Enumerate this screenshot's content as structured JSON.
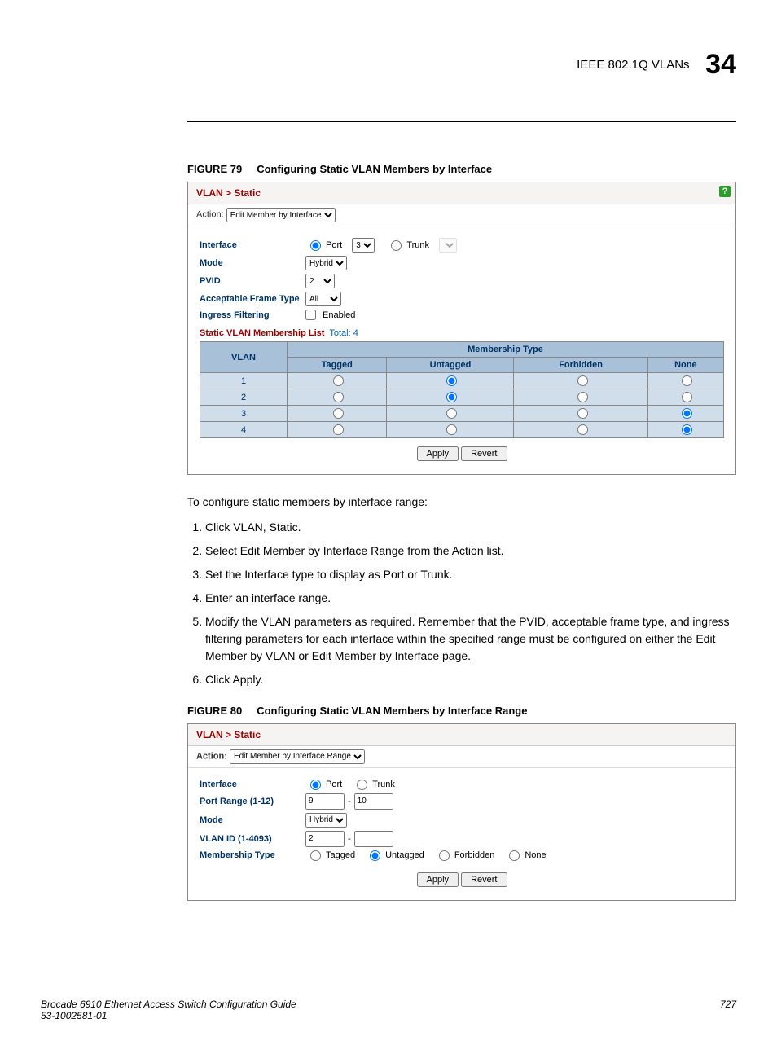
{
  "header": {
    "section": "IEEE 802.1Q VLANs",
    "chapter": "34"
  },
  "fig79": {
    "label": "FIGURE 79",
    "caption": "Configuring Static VLAN Members by Interface",
    "breadcrumb": "VLAN > Static",
    "action_label": "Action:",
    "action_value": "Edit Member by Interface",
    "rows": {
      "interface": "Interface",
      "port_label": "Port",
      "port_value": "3",
      "trunk_label": "Trunk",
      "mode": "Mode",
      "mode_value": "Hybrid",
      "pvid": "PVID",
      "pvid_value": "2",
      "aft": "Acceptable Frame Type",
      "aft_value": "All",
      "ingress": "Ingress Filtering",
      "enabled": "Enabled"
    },
    "list_title_red": "Static VLAN Membership List",
    "list_title_blue": "Total: 4",
    "table": {
      "vlan_header": "VLAN",
      "membership_header": "Membership Type",
      "cols": [
        "Tagged",
        "Untagged",
        "Forbidden",
        "None"
      ],
      "rows": [
        {
          "vlan": "1",
          "sel": 1
        },
        {
          "vlan": "2",
          "sel": 1
        },
        {
          "vlan": "3",
          "sel": 3
        },
        {
          "vlan": "4",
          "sel": 3
        }
      ]
    },
    "apply": "Apply",
    "revert": "Revert"
  },
  "intro": "To configure static members by interface range:",
  "steps": [
    "Click VLAN, Static.",
    "Select Edit Member by Interface Range from the Action list.",
    "Set the Interface type to display as Port or Trunk.",
    "Enter an interface range.",
    "Modify the VLAN parameters as required. Remember that the PVID, acceptable frame type, and ingress filtering parameters for each interface within the specified range must be configured on either the Edit Member by VLAN or Edit Member by Interface page.",
    "Click Apply."
  ],
  "fig80": {
    "label": "FIGURE 80",
    "caption": "Configuring Static VLAN Members by Interface Range",
    "breadcrumb": "VLAN > Static",
    "action_label": "Action:",
    "action_value": "Edit Member by Interface Range",
    "rows": {
      "interface": "Interface",
      "port": "Port",
      "trunk": "Trunk",
      "range": "Port Range (1-12)",
      "range_from": "9",
      "range_to": "10",
      "mode": "Mode",
      "mode_value": "Hybrid",
      "vlanid": "VLAN ID (1-4093)",
      "vlanid_value": "2",
      "mtype": "Membership Type",
      "tagged": "Tagged",
      "untagged": "Untagged",
      "forbidden": "Forbidden",
      "none": "None"
    },
    "apply": "Apply",
    "revert": "Revert"
  },
  "footer": {
    "left1": "Brocade 6910 Ethernet Access Switch Configuration Guide",
    "left2": "53-1002581-01",
    "page": "727"
  }
}
